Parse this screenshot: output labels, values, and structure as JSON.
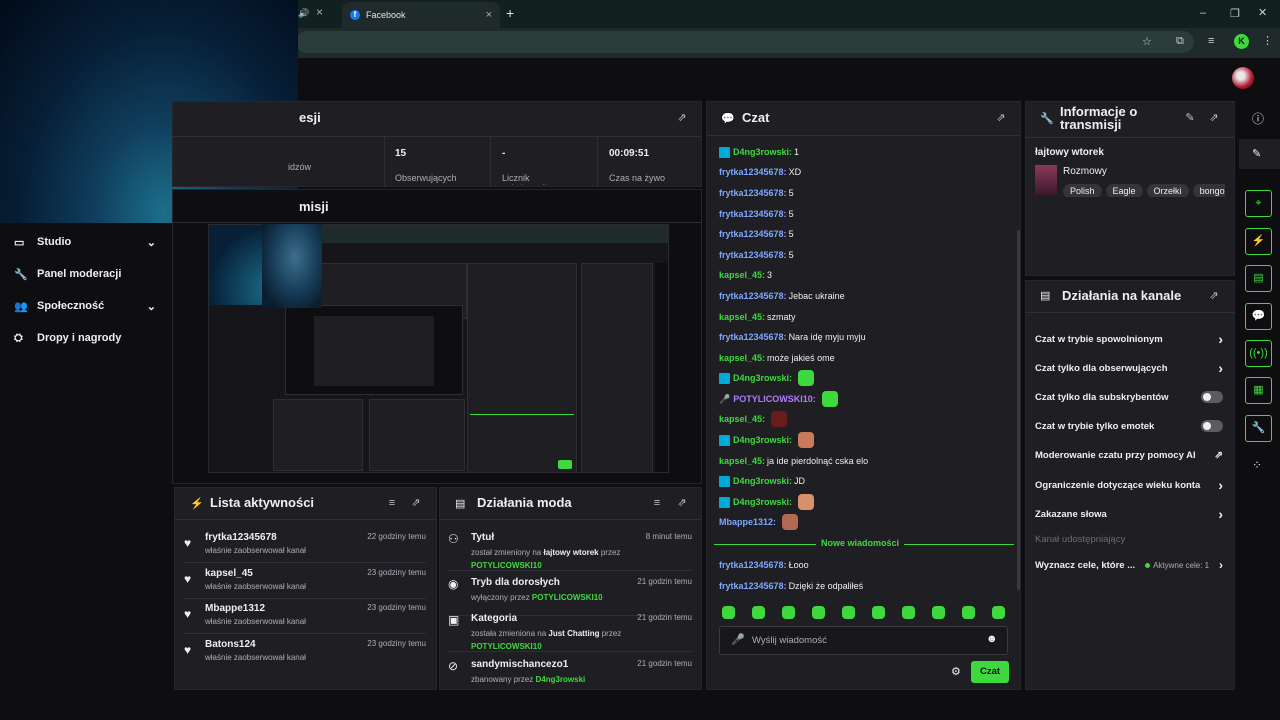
{
  "browser": {
    "tabs": [
      {
        "label": "Facebook",
        "icon": "facebook-icon"
      }
    ],
    "profile_initial": "K"
  },
  "sidebar": {
    "items": [
      {
        "label": "Studio",
        "icon": "studio-icon",
        "expandable": true
      },
      {
        "label": "Panel moderacji",
        "icon": "wrench-icon",
        "expandable": false
      },
      {
        "label": "Społeczność",
        "icon": "community-icon",
        "expandable": true
      },
      {
        "label": "Dropy i nagrody",
        "icon": "rewards-icon",
        "expandable": false
      }
    ]
  },
  "stream_stats": {
    "header_partial": "esji",
    "items": [
      {
        "value": "",
        "label": "idzów"
      },
      {
        "value": "15",
        "label": "Obserwujących"
      },
      {
        "value": "-",
        "label": "Licznik subskrypcji"
      },
      {
        "value": "00:09:51",
        "label": "Czas na żywo"
      }
    ]
  },
  "preview": {
    "header_partial": "misji"
  },
  "activity": {
    "title": "Lista aktywności",
    "items": [
      {
        "name": "frytka12345678",
        "time": "22 godziny temu",
        "desc": "właśnie zaobserwował kanał"
      },
      {
        "name": "kapsel_45",
        "time": "23 godziny temu",
        "desc": "właśnie zaobserwował kanał"
      },
      {
        "name": "Mbappe1312",
        "time": "23 godziny temu",
        "desc": "właśnie zaobserwował kanał"
      },
      {
        "name": "Batons124",
        "time": "23 godziny temu",
        "desc": "właśnie zaobserwował kanał"
      }
    ]
  },
  "mod_actions": {
    "title": "Działania moda",
    "items": [
      {
        "icon": "title-icon",
        "name": "Tytuł",
        "time": "8 minut temu",
        "pre": "został zmieniony na ",
        "value": "łajtowy wtorek",
        "mid": " przez ",
        "by": "POTYLICOWSKI10"
      },
      {
        "icon": "eye-icon",
        "name": "Tryb dla dorosłych",
        "time": "21 godzin temu",
        "pre": "wyłączony przez ",
        "value": "",
        "mid": "",
        "by": "POTYLICOWSKI10"
      },
      {
        "icon": "category-icon",
        "name": "Kategoria",
        "time": "21 godzin temu",
        "pre": "została zmieniona na ",
        "value": "Just Chatting",
        "mid": " przez ",
        "by": "POTYLICOWSKI10"
      },
      {
        "icon": "ban-icon",
        "name": "sandymischancezo1",
        "time": "21 godzin temu",
        "pre": "zbanowany przez ",
        "value": "",
        "mid": "",
        "by": "D4ng3rowski"
      }
    ]
  },
  "chat": {
    "title": "Czat",
    "messages": [
      {
        "user": "D4ng3rowski",
        "color": "#3ed93e",
        "badge": "mod",
        "text": "1",
        "emote": null
      },
      {
        "user": "frytka12345678",
        "color": "#7ea7ff",
        "badge": null,
        "text": "XD",
        "emote": null
      },
      {
        "user": "frytka12345678",
        "color": "#7ea7ff",
        "badge": null,
        "text": "5",
        "emote": null
      },
      {
        "user": "frytka12345678",
        "color": "#7ea7ff",
        "badge": null,
        "text": "5",
        "emote": null
      },
      {
        "user": "frytka12345678",
        "color": "#7ea7ff",
        "badge": null,
        "text": "5",
        "emote": null
      },
      {
        "user": "frytka12345678",
        "color": "#7ea7ff",
        "badge": null,
        "text": "5",
        "emote": null
      },
      {
        "user": "kapsel_45",
        "color": "#3ed93e",
        "badge": null,
        "text": "3",
        "emote": null
      },
      {
        "user": "frytka12345678",
        "color": "#7ea7ff",
        "badge": null,
        "text": "Jebac ukraine",
        "emote": null
      },
      {
        "user": "kapsel_45",
        "color": "#3ed93e",
        "badge": null,
        "text": "szmaty",
        "emote": null
      },
      {
        "user": "frytka12345678",
        "color": "#7ea7ff",
        "badge": null,
        "text": "Nara idę myju myju",
        "emote": null
      },
      {
        "user": "kapsel_45",
        "color": "#3ed93e",
        "badge": null,
        "text": "może jakieś ome",
        "emote": null
      },
      {
        "user": "D4ng3rowski",
        "color": "#3ed93e",
        "badge": "mod",
        "text": "",
        "emote": "#3ed93e"
      },
      {
        "user": "POTYLICOWSKI10",
        "color": "#b07cff",
        "badge": "broadcaster",
        "text": "",
        "emote": "#3ed93e"
      },
      {
        "user": "kapsel_45",
        "color": "#3ed93e",
        "badge": null,
        "text": "",
        "emote": "#6a1c1c"
      },
      {
        "user": "D4ng3rowski",
        "color": "#3ed93e",
        "badge": "mod",
        "text": "",
        "emote": "#c97a5a"
      },
      {
        "user": "kapsel_45",
        "color": "#3ed93e",
        "badge": null,
        "text": "ja ide pierdolnąć cska elo",
        "emote": null
      },
      {
        "user": "D4ng3rowski",
        "color": "#3ed93e",
        "badge": "mod",
        "text": "JD",
        "emote": null
      },
      {
        "user": "D4ng3rowski",
        "color": "#3ed93e",
        "badge": "mod",
        "text": "",
        "emote": "#d9906a"
      },
      {
        "user": "Mbappe1312",
        "color": "#7ea7ff",
        "badge": null,
        "text": "",
        "emote": "#b46a52"
      }
    ],
    "new_messages_label": "Nowe wiadomości",
    "new_messages": [
      {
        "user": "frytka12345678",
        "color": "#7ea7ff",
        "text": "Łooo"
      },
      {
        "user": "frytka12345678",
        "color": "#7ea7ff",
        "text": "Dzięki że odpaliłeś"
      }
    ],
    "input_placeholder": "Wyślij wiadomość",
    "send_label": "Czat"
  },
  "stream_info": {
    "title": "Informacje o transmisji",
    "stream_title": "łajtowy wtorek",
    "category": "Rozmowy",
    "tags": [
      "Polish",
      "Eagle",
      "Orzełki",
      "bongo"
    ]
  },
  "channel_actions": {
    "title": "Działania na kanale",
    "items": [
      {
        "label": "Czat w trybie spowolnionym",
        "control": "chevron"
      },
      {
        "label": "Czat tylko dla obserwujących",
        "control": "chevron"
      },
      {
        "label": "Czat tylko dla subskrybentów",
        "control": "toggle"
      },
      {
        "label": "Czat w trybie tylko emotek",
        "control": "toggle"
      },
      {
        "label": "Moderowanie czatu przy pomocy AI",
        "control": "external"
      },
      {
        "label": "Ograniczenie dotyczące wieku konta",
        "control": "chevron"
      },
      {
        "label": "Zakazane słowa",
        "control": "chevron"
      }
    ],
    "disabled_item": "Kanał udostępniający",
    "goal_label": "Wyznacz cele, które ...",
    "goal_status": "Aktywne cele: 1"
  },
  "colors": {
    "accent": "#3ed93e",
    "panel": "#1f1f23",
    "background": "#0e0e10"
  }
}
